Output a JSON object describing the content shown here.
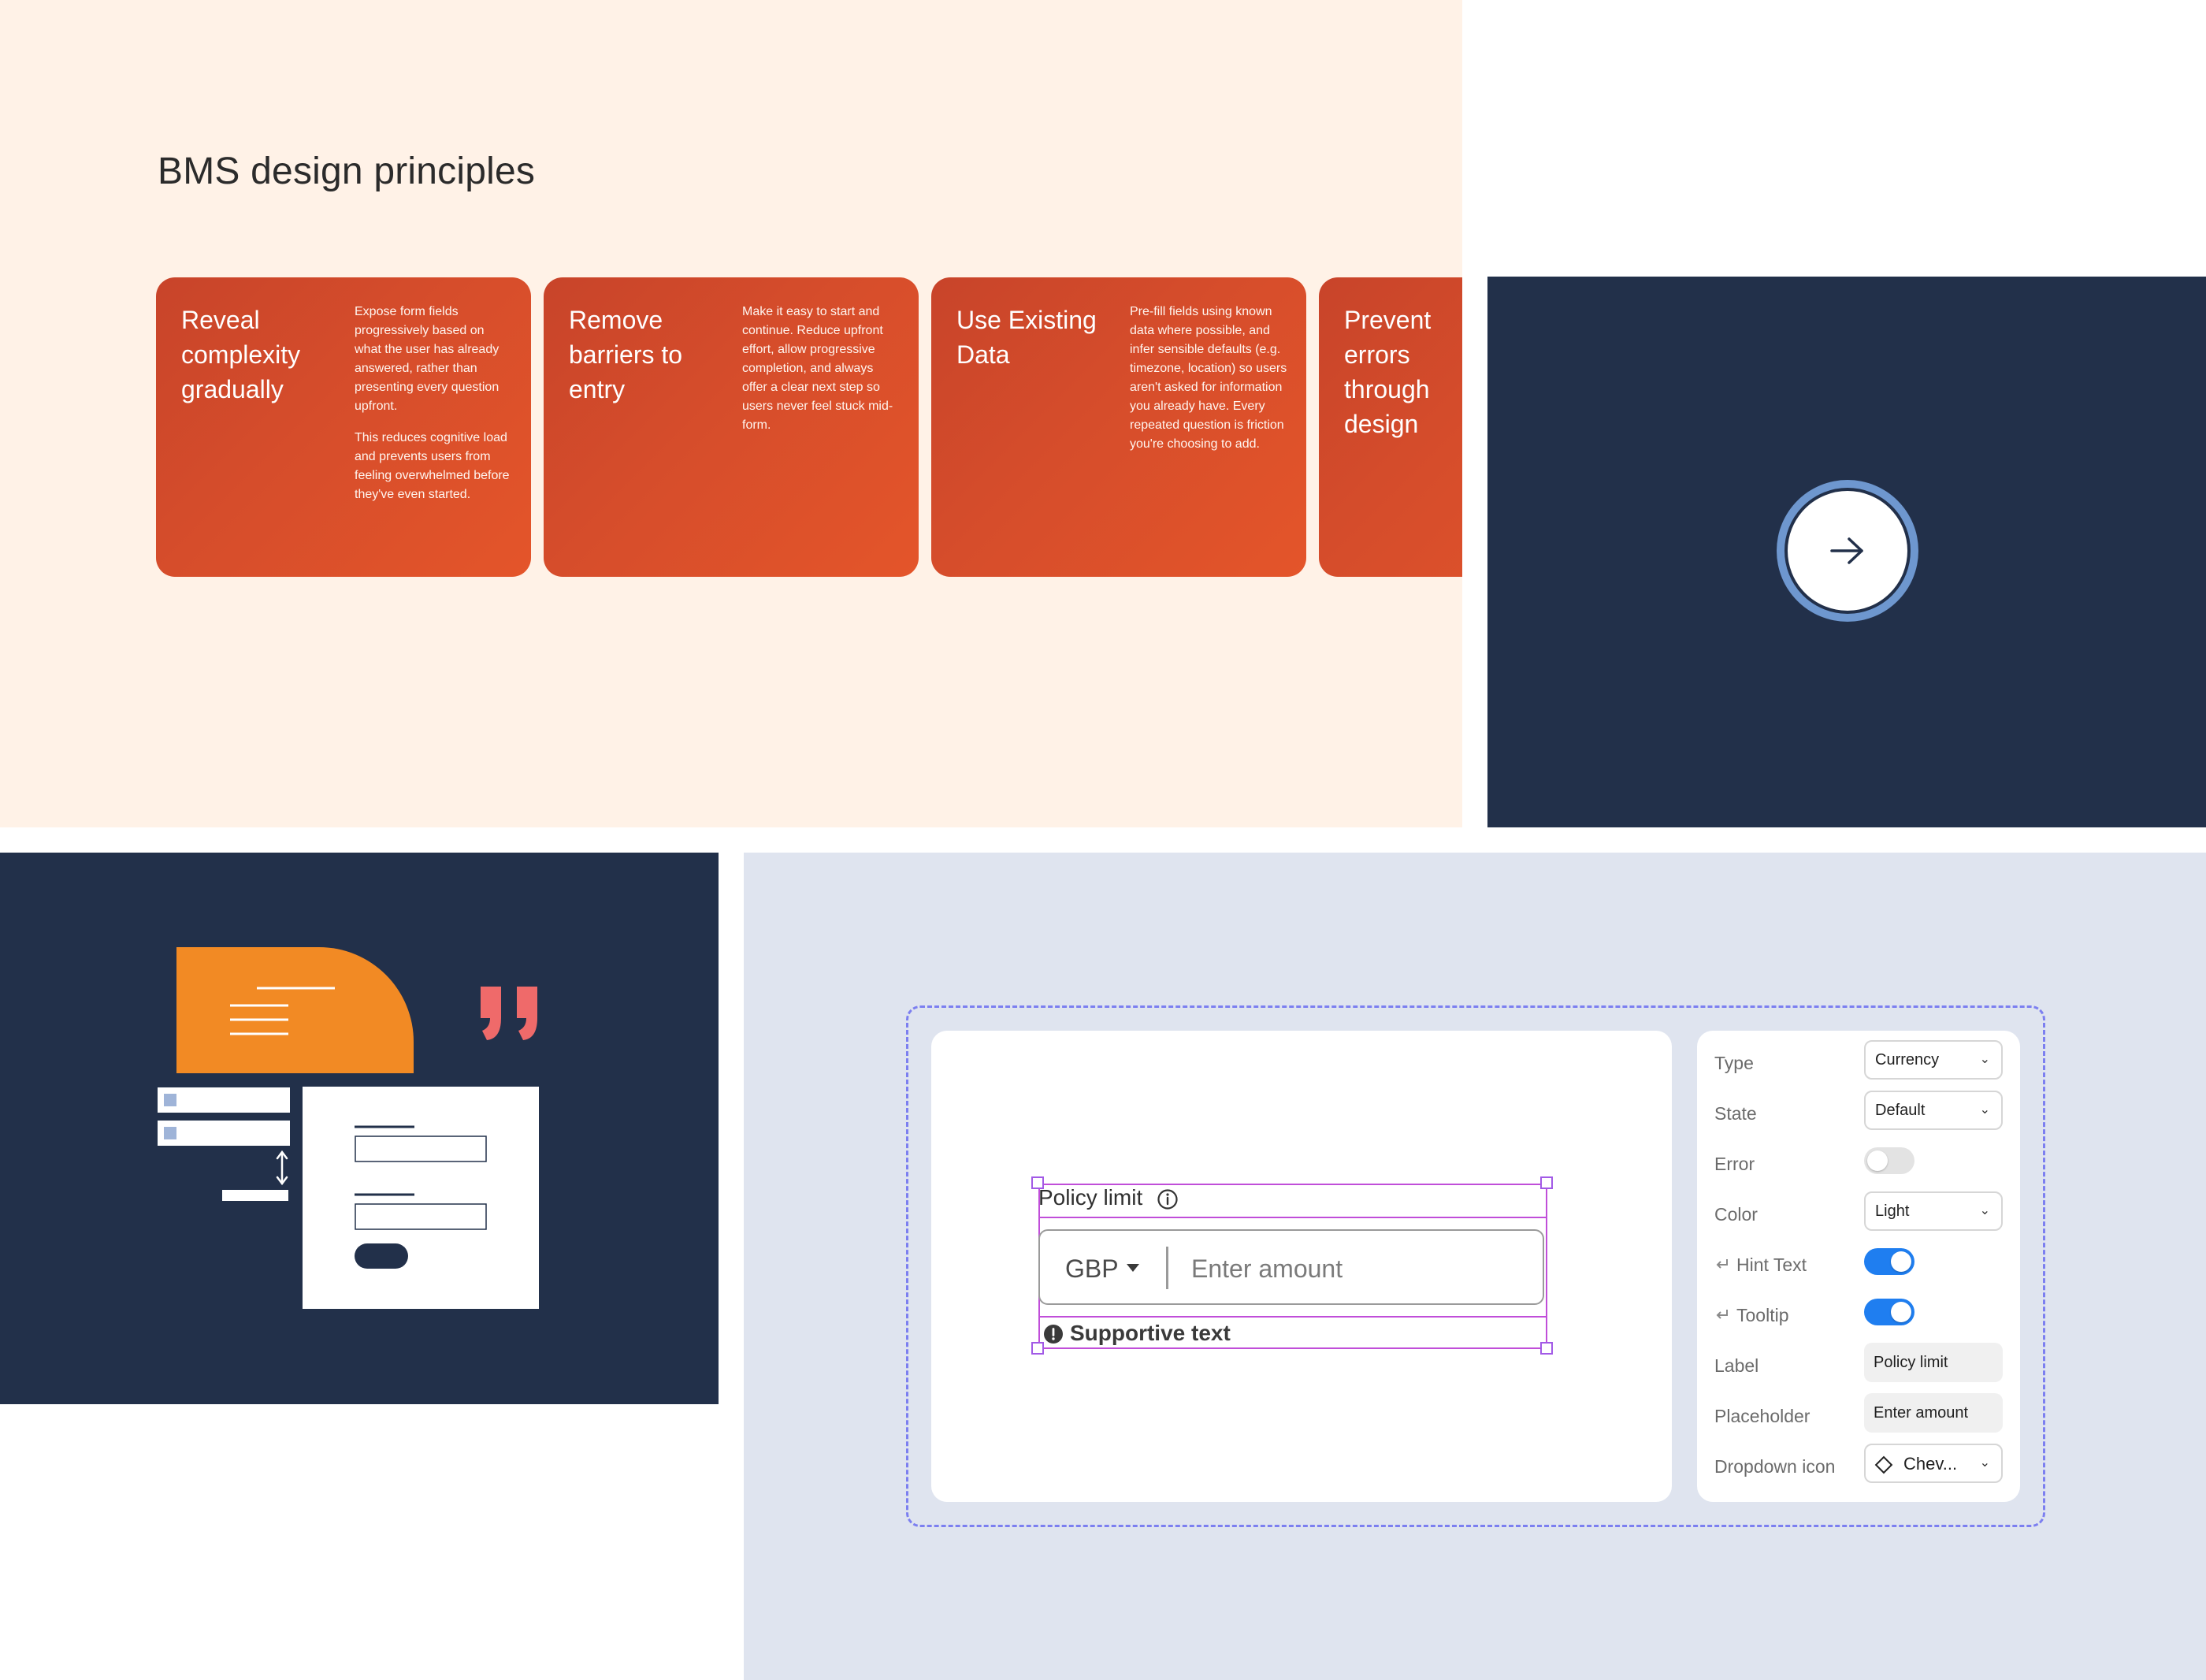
{
  "principles": {
    "title": "BMS design principles",
    "cards": [
      {
        "title": "Reveal complexity gradually",
        "body": [
          "Expose form fields progressively based on what the user has already answered, rather than presenting every question upfront.",
          "This reduces cognitive load and prevents users from feeling overwhelmed before they've even started."
        ]
      },
      {
        "title": "Remove barriers to entry",
        "body": [
          "Make it easy to start and continue. Reduce upfront effort, allow progressive completion, and always offer a clear next step so users never feel stuck mid-form."
        ]
      },
      {
        "title": "Use Existing Data",
        "body": [
          "Pre-fill fields using known data where possible, and infer sensible defaults (e.g. timezone, location) so users aren't asked for information you already have. Every repeated question is friction you're choosing to add."
        ]
      },
      {
        "title": "Prevent errors through design",
        "body": []
      }
    ],
    "colors": {
      "background": "#fff2e7",
      "card": "#d64d2b"
    }
  },
  "next_panel": {
    "icon": "arrow-right-icon",
    "colors": {
      "background": "#22304a",
      "ring": "#6e97cf"
    }
  },
  "illustration": {
    "icons": [
      "speech-bubble-icon",
      "quote-marks-icon",
      "form-card-icon",
      "checkbox-list-icon",
      "vertical-resize-icon"
    ],
    "colors": {
      "background": "#22304a",
      "bubble": "#f28a24",
      "quote": "#ef6a6a",
      "accent": "#9fb4d8"
    }
  },
  "component": {
    "field": {
      "label": "Policy limit",
      "info_icon": "info-icon",
      "currency": "GBP",
      "dropdown_icon": "caret-down-icon",
      "placeholder": "Enter amount",
      "support_text": "Supportive text",
      "support_icon": "alert-icon"
    },
    "props": {
      "type": {
        "name": "Type",
        "value": "Currency"
      },
      "state": {
        "name": "State",
        "value": "Default"
      },
      "error": {
        "name": "Error",
        "enabled": false
      },
      "color": {
        "name": "Color",
        "value": "Light"
      },
      "hint_text": {
        "name": "Hint Text",
        "enabled": true
      },
      "tooltip": {
        "name": "Tooltip",
        "enabled": true
      },
      "label": {
        "name": "Label",
        "value": "Policy limit"
      },
      "placeholder": {
        "name": "Placeholder",
        "value": "Enter amount"
      },
      "dropdown_icon": {
        "name": "Dropdown icon",
        "value": "Chev..."
      }
    },
    "colors": {
      "background": "#dfe4ef",
      "selection": "#c04ed9",
      "frame": "#7c7ff0",
      "toggle_on": "#1f7ef0"
    }
  }
}
